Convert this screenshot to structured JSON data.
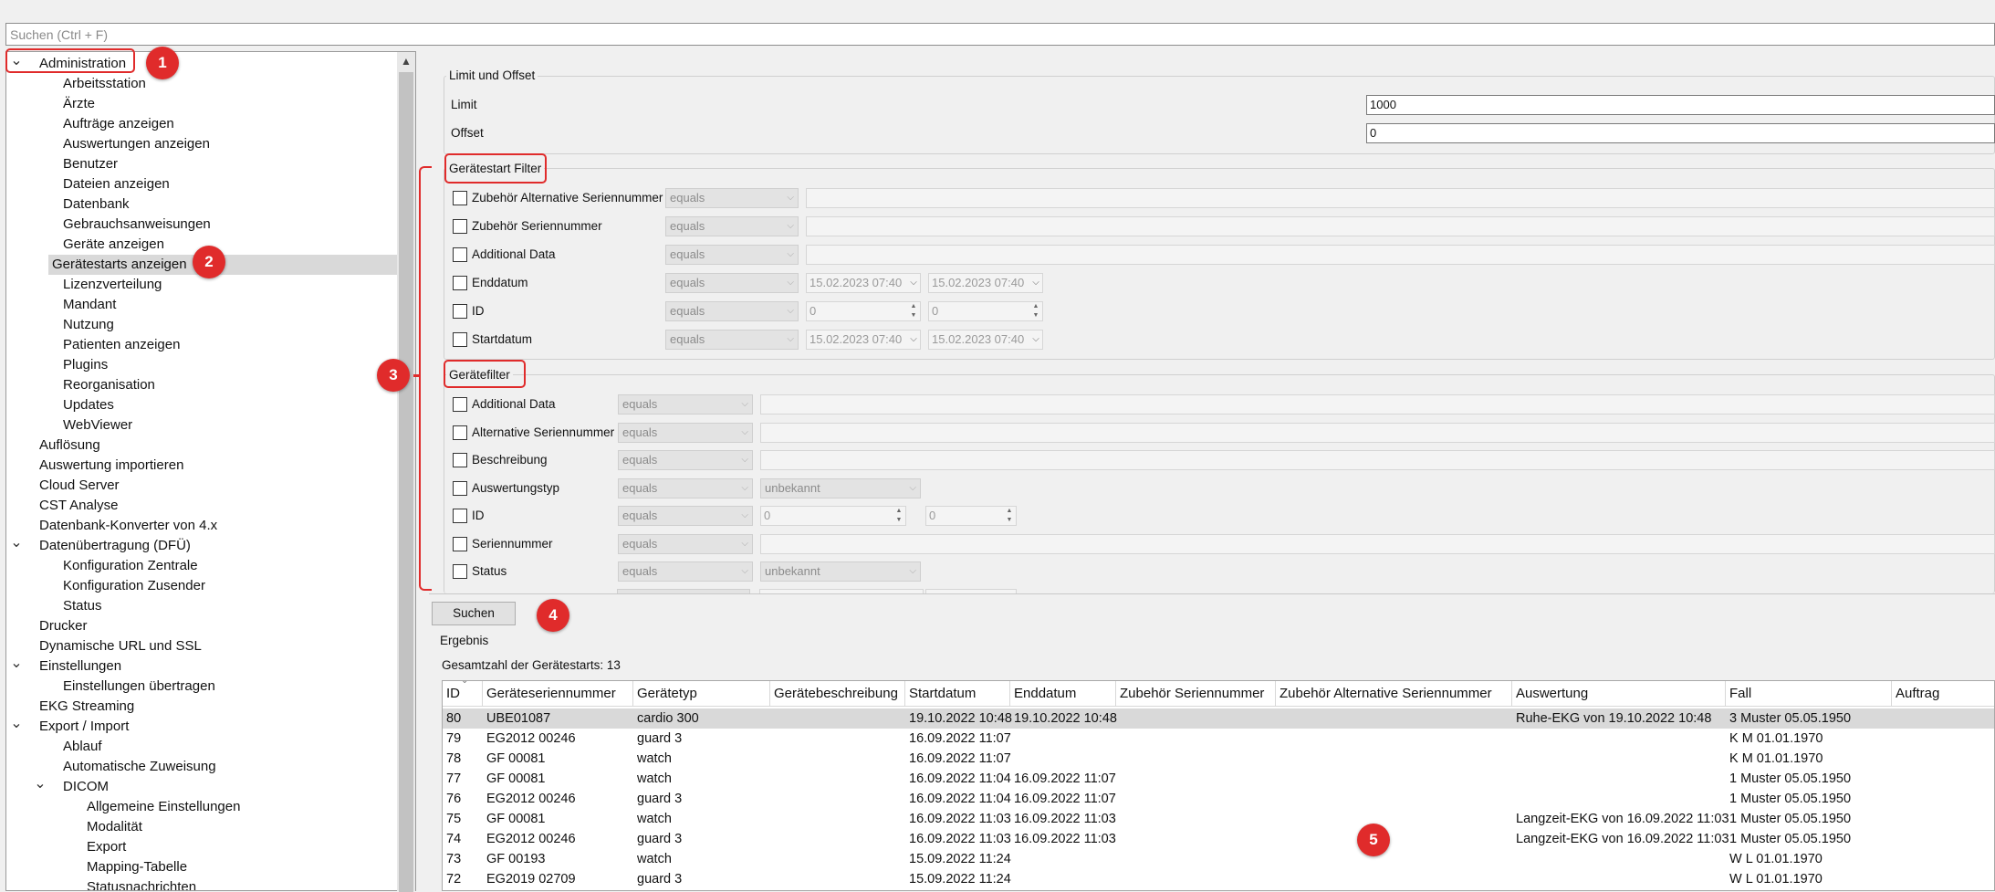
{
  "search": {
    "placeholder": "Suchen (Ctrl + F)"
  },
  "tree": {
    "items": [
      {
        "label": "Administration",
        "level": 0,
        "expander": "v"
      },
      {
        "label": "Arbeitsstation",
        "level": 1
      },
      {
        "label": "Ärzte",
        "level": 1
      },
      {
        "label": "Aufträge anzeigen",
        "level": 1
      },
      {
        "label": "Auswertungen anzeigen",
        "level": 1
      },
      {
        "label": "Benutzer",
        "level": 1
      },
      {
        "label": "Dateien anzeigen",
        "level": 1
      },
      {
        "label": "Datenbank",
        "level": 1
      },
      {
        "label": "Gebrauchsanweisungen",
        "level": 1
      },
      {
        "label": "Geräte anzeigen",
        "level": 1
      },
      {
        "label": "Gerätestarts anzeigen",
        "level": 1,
        "selected": true
      },
      {
        "label": "Lizenzverteilung",
        "level": 1
      },
      {
        "label": "Mandant",
        "level": 1
      },
      {
        "label": "Nutzung",
        "level": 1
      },
      {
        "label": "Patienten anzeigen",
        "level": 1
      },
      {
        "label": "Plugins",
        "level": 1
      },
      {
        "label": "Reorganisation",
        "level": 1
      },
      {
        "label": "Updates",
        "level": 1
      },
      {
        "label": "WebViewer",
        "level": 1
      },
      {
        "label": "Auflösung",
        "level": 0
      },
      {
        "label": "Auswertung importieren",
        "level": 0
      },
      {
        "label": "Cloud Server",
        "level": 0
      },
      {
        "label": "CST Analyse",
        "level": 0
      },
      {
        "label": "Datenbank-Konverter von 4.x",
        "level": 0
      },
      {
        "label": "Datenübertragung (DFÜ)",
        "level": 0,
        "expander": "v"
      },
      {
        "label": "Konfiguration Zentrale",
        "level": 1
      },
      {
        "label": "Konfiguration Zusender",
        "level": 1
      },
      {
        "label": "Status",
        "level": 1
      },
      {
        "label": "Drucker",
        "level": 0
      },
      {
        "label": "Dynamische URL und SSL",
        "level": 0
      },
      {
        "label": "Einstellungen",
        "level": 0,
        "expander": "v"
      },
      {
        "label": "Einstellungen übertragen",
        "level": 1
      },
      {
        "label": "EKG Streaming",
        "level": 0
      },
      {
        "label": "Export / Import",
        "level": 0,
        "expander": "v"
      },
      {
        "label": "Ablauf",
        "level": 1
      },
      {
        "label": "Automatische Zuweisung",
        "level": 1
      },
      {
        "label": "DICOM",
        "level": 1,
        "expander": "v"
      },
      {
        "label": "Allgemeine Einstellungen",
        "level": 2
      },
      {
        "label": "Modalität",
        "level": 2
      },
      {
        "label": "Export",
        "level": 2
      },
      {
        "label": "Mapping-Tabelle",
        "level": 2
      },
      {
        "label": "Statusnachrichten",
        "level": 2
      }
    ]
  },
  "limit_offset": {
    "title": "Limit und Offset",
    "limit_label": "Limit",
    "limit_value": "1000",
    "offset_label": "Offset",
    "offset_value": "0"
  },
  "geraetestart_filter": {
    "title": "Gerätestart Filter",
    "rows": [
      {
        "label": "Zubehör Alternative Seriennummer",
        "op": "equals",
        "kind": "text"
      },
      {
        "label": "Zubehör Seriennummer",
        "op": "equals",
        "kind": "text"
      },
      {
        "label": "Additional Data",
        "op": "equals",
        "kind": "text"
      },
      {
        "label": "Enddatum",
        "op": "equals",
        "kind": "date",
        "v1": "15.02.2023 07:40",
        "v2": "15.02.2023 07:40"
      },
      {
        "label": "ID",
        "op": "equals",
        "kind": "num",
        "v1": "0",
        "v2": "0"
      },
      {
        "label": "Startdatum",
        "op": "equals",
        "kind": "date",
        "v1": "15.02.2023 07:40",
        "v2": "15.02.2023 07:40"
      }
    ]
  },
  "geraetefilter": {
    "title": "Gerätefilter",
    "rows": [
      {
        "label": "Additional Data",
        "op": "equals",
        "kind": "text"
      },
      {
        "label": "Alternative Seriennummer",
        "op": "equals",
        "kind": "text"
      },
      {
        "label": "Beschreibung",
        "op": "equals",
        "kind": "text"
      },
      {
        "label": "Auswertungstyp",
        "op": "equals",
        "kind": "enum",
        "v1": "unbekannt"
      },
      {
        "label": "ID",
        "op": "equals",
        "kind": "num",
        "v1": "0",
        "v2": "0"
      },
      {
        "label": "Seriennummer",
        "op": "equals",
        "kind": "text"
      },
      {
        "label": "Status",
        "op": "equals",
        "kind": "enum",
        "v1": "unbekannt"
      }
    ]
  },
  "search_button": "Suchen",
  "result": {
    "title": "Ergebnis",
    "count_text": "Gesamtzahl der Gerätestarts: 13",
    "columns": [
      "ID",
      "Geräteseriennummer",
      "Gerätetyp",
      "Gerätebeschreibung",
      "Startdatum",
      "Enddatum",
      "Zubehör Seriennummer",
      "Zubehör Alternative Seriennummer",
      "Auswertung",
      "Fall",
      "Auftrag"
    ],
    "rows": [
      [
        "80",
        "UBE01087",
        "cardio 300",
        "",
        "19.10.2022 10:48",
        "19.10.2022 10:48",
        "",
        "",
        "Ruhe-EKG von 19.10.2022 10:48",
        "3 Muster 05.05.1950",
        ""
      ],
      [
        "79",
        "EG2012 00246",
        "guard 3",
        "",
        "16.09.2022 11:07",
        "",
        "",
        "",
        "",
        "K M 01.01.1970",
        ""
      ],
      [
        "78",
        "GF 00081",
        "watch",
        "",
        "16.09.2022 11:07",
        "",
        "",
        "",
        "",
        "K M 01.01.1970",
        ""
      ],
      [
        "77",
        "GF 00081",
        "watch",
        "",
        "16.09.2022 11:04",
        "16.09.2022 11:07",
        "",
        "",
        "",
        "1 Muster 05.05.1950",
        ""
      ],
      [
        "76",
        "EG2012 00246",
        "guard 3",
        "",
        "16.09.2022 11:04",
        "16.09.2022 11:07",
        "",
        "",
        "",
        "1 Muster 05.05.1950",
        ""
      ],
      [
        "75",
        "GF 00081",
        "watch",
        "",
        "16.09.2022 11:03",
        "16.09.2022 11:03",
        "",
        "",
        "Langzeit-EKG von 16.09.2022 11:03",
        "1 Muster 05.05.1950",
        ""
      ],
      [
        "74",
        "EG2012 00246",
        "guard 3",
        "",
        "16.09.2022 11:03",
        "16.09.2022 11:03",
        "",
        "",
        "Langzeit-EKG von 16.09.2022 11:03",
        "1 Muster 05.05.1950",
        ""
      ],
      [
        "73",
        "GF 00193",
        "watch",
        "",
        "15.09.2022 11:24",
        "",
        "",
        "",
        "",
        "W L 01.01.1970",
        ""
      ],
      [
        "72",
        "EG2019 02709",
        "guard 3",
        "",
        "15.09.2022 11:24",
        "",
        "",
        "",
        "",
        "W L 01.01.1970",
        ""
      ]
    ]
  },
  "annotations": [
    "1",
    "2",
    "3",
    "4",
    "5"
  ],
  "colors": {
    "annotation": "#e02b2b",
    "selection": "#d9d9d9"
  }
}
